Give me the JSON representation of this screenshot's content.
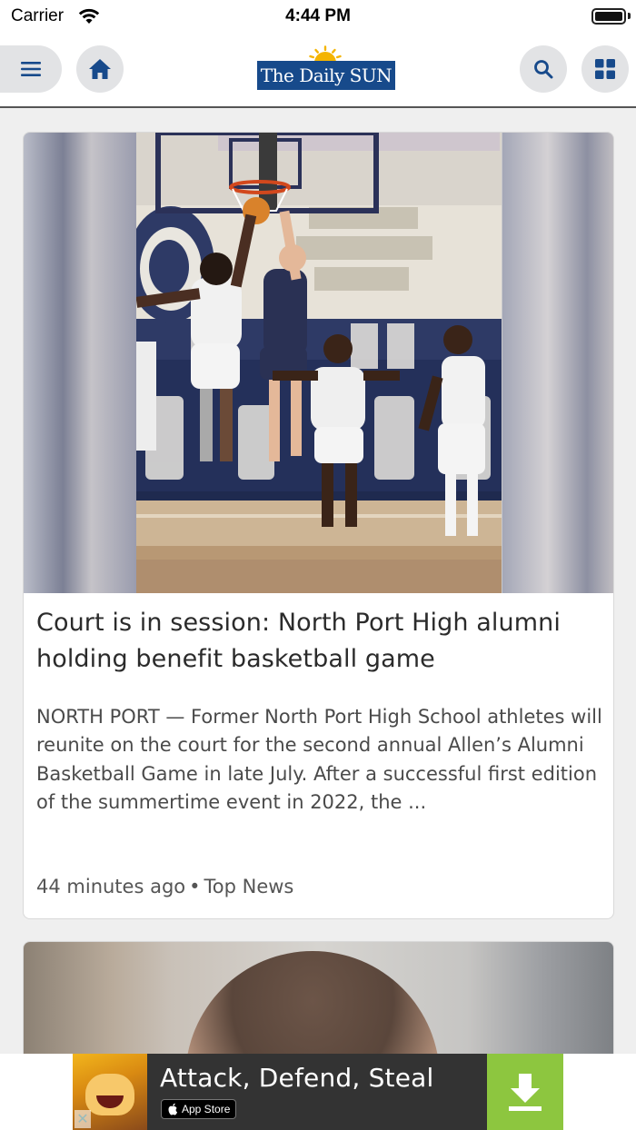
{
  "status_bar": {
    "carrier": "Carrier",
    "time": "4:44 PM"
  },
  "header": {
    "logo_text": "The Daily SUN",
    "brand_color": "#174a8b",
    "buttons": {
      "menu_icon": "hamburger-icon",
      "home_icon": "home-icon",
      "search_icon": "search-icon",
      "sections_icon": "grid-icon"
    },
    "accent_color": "#174a8b"
  },
  "articles": [
    {
      "image_alt": "North Port High basketball players leaping for a rebound under the hoop",
      "title": "Court is in session: North Port High alumni holding benefit basketball game",
      "summary": "NORTH PORT — Former North Port High School athletes will reunite on the court for the second annual Allen’s Alumni Basketball Game in late July. After a successful first edition of the summertime event in 2022, the ...",
      "time_ago": "44 minutes ago",
      "separator": "•",
      "section": "Top News"
    },
    {
      "image_alt": "Booking photo of a man"
    }
  ],
  "ad": {
    "title": "Attack, Defend, Steal",
    "store_label": "App Store",
    "cta_icon": "download-icon",
    "close_icon": "close-icon",
    "cta_color": "#8dc63f"
  }
}
